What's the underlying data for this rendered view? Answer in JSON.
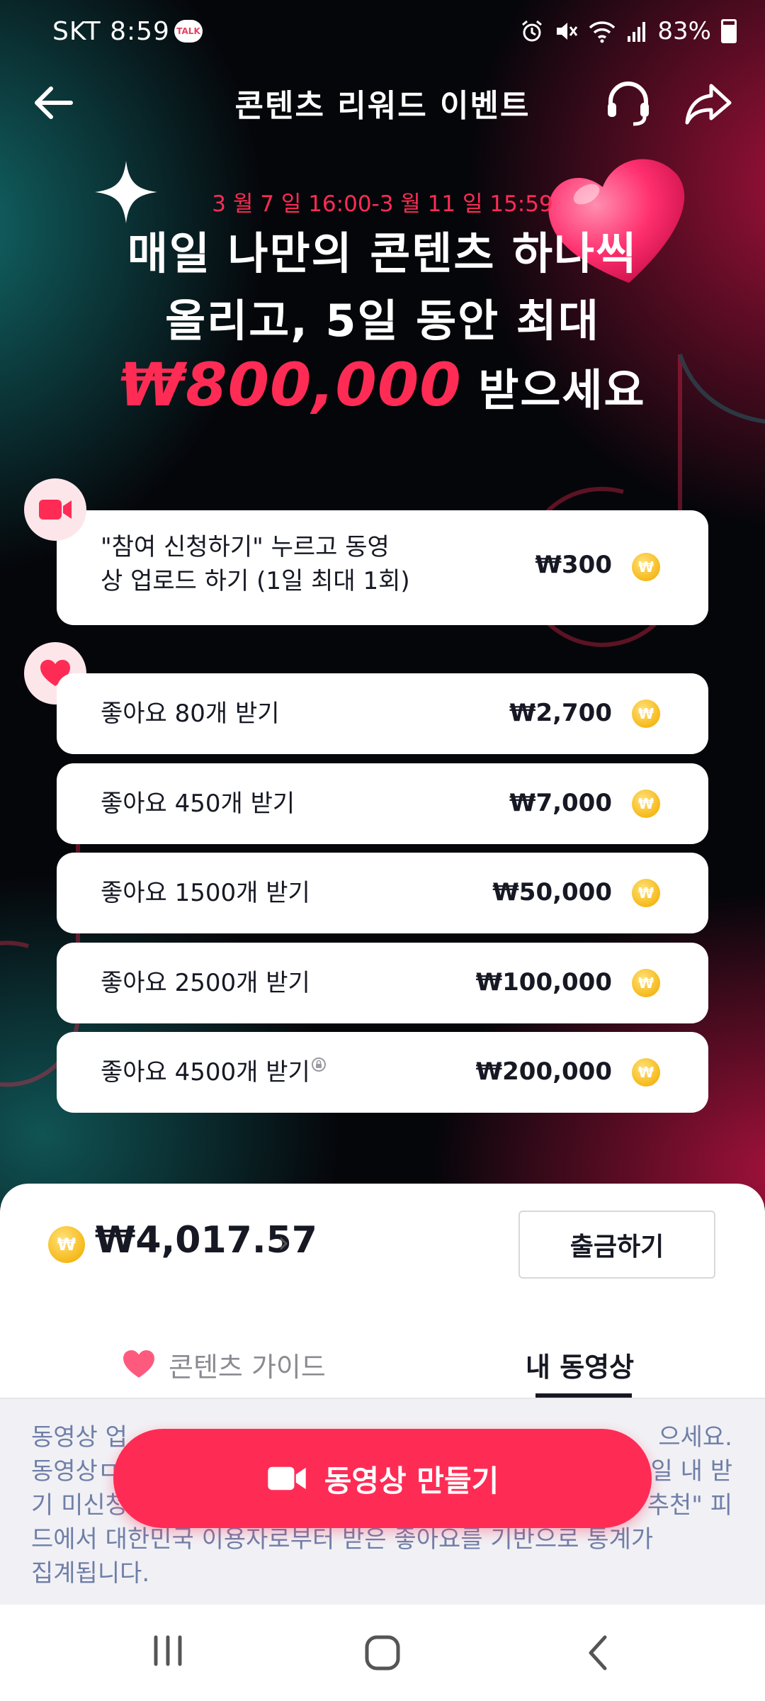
{
  "status_bar": {
    "carrier_time": "SKT 8:59",
    "talk_badge": "TALK",
    "battery": "83%",
    "icons": [
      "alarm-icon",
      "mute-icon",
      "wifi-icon",
      "signal-icon",
      "battery-icon"
    ]
  },
  "header": {
    "title": "콘텐츠 리워드 이벤트",
    "icons": [
      "back-arrow-icon",
      "headset-icon",
      "share-icon"
    ]
  },
  "hero": {
    "date_range": "3 월 7 일 16:00-3 월 11 일 15:59",
    "headline_line1": "매일 나만의 콘텐츠 하나씩",
    "headline_line2": "올리고, 5일 동안 최대",
    "headline_amount": "₩800,000",
    "headline_suffix": "받으세요",
    "accent_color": "#fe2c55"
  },
  "upload_task": {
    "label_line1": "\"참여 신청하기\" 누르고 동영",
    "label_line2": "상 업로드 하기 (1일 최대 1회)",
    "reward": "₩300",
    "icon": "video-camera-icon"
  },
  "like_tasks": [
    {
      "label": "좋아요 80개 받기",
      "reward": "₩2,700",
      "locked": false
    },
    {
      "label": "좋아요 450개 받기",
      "reward": "₩7,000",
      "locked": false
    },
    {
      "label": "좋아요 1500개 받기",
      "reward": "₩50,000",
      "locked": false
    },
    {
      "label": "좋아요 2500개 받기",
      "reward": "₩100,000",
      "locked": false
    },
    {
      "label": "좋아요 4500개 받기",
      "reward": "₩200,000",
      "locked": true
    }
  ],
  "coin_symbol": "₩",
  "balance": {
    "amount": "₩4,017.57",
    "withdraw_label": "출금하기"
  },
  "tabs": {
    "guide_label": "콘텐츠 가이드",
    "my_videos_label": "내 동영상",
    "selected": "my_videos"
  },
  "info": {
    "line1": "동영상 업",
    "line1_end": "으세요.",
    "line2": "동영상ㅁ",
    "line2_end": "일 내 받",
    "line3": "기 미신청",
    "line3_end": "추천\" 피",
    "line4": "드에서 대한민국 이용자로부터 받은 좋아요를 기반으로 통계가",
    "line5": "집계됩니다."
  },
  "cta": {
    "label": "동영상 만들기",
    "color": "#fe2c55"
  },
  "system_nav": [
    "recent-apps-icon",
    "home-icon",
    "back-icon"
  ]
}
